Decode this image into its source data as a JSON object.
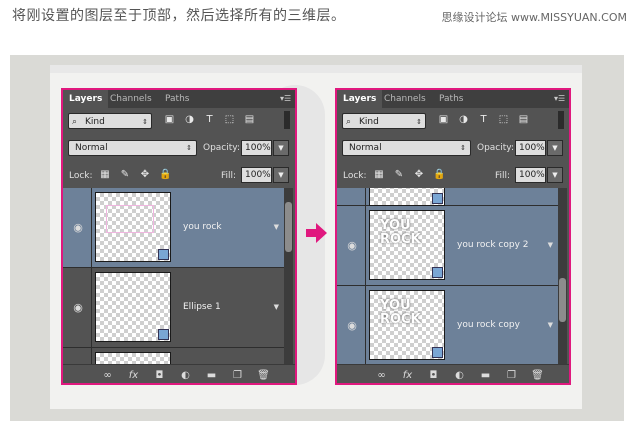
{
  "caption": "将刚设置的图层至于顶部，然后选择所有的三维层。",
  "watermark": "思缘设计论坛 www.MISSYUAN.COM",
  "colors": {
    "highlight_border": "#e0187e",
    "selected_layer": "#6d8199",
    "panel_bg": "#535353"
  },
  "panels": [
    {
      "tabs": [
        "Layers",
        "Channels",
        "Paths"
      ],
      "filter": {
        "label": "Kind",
        "icon": "search-icon"
      },
      "blend_mode": "Normal",
      "opacity_label": "Opacity:",
      "opacity_value": "100%",
      "lock_label": "Lock:",
      "fill_label": "Fill:",
      "fill_value": "100%",
      "layers": [
        {
          "name": "you rock",
          "selected": true
        },
        {
          "name": "Ellipse 1",
          "selected": false
        }
      ]
    },
    {
      "tabs": [
        "Layers",
        "Channels",
        "Paths"
      ],
      "filter": {
        "label": "Kind",
        "icon": "search-icon"
      },
      "blend_mode": "Normal",
      "opacity_label": "Opacity:",
      "opacity_value": "100%",
      "lock_label": "Lock:",
      "fill_label": "Fill:",
      "fill_value": "100%",
      "layers": [
        {
          "name": "you rock copy 2",
          "selected": true
        },
        {
          "name": "you rock copy",
          "selected": true
        }
      ]
    }
  ],
  "arrow_icon": "arrow-right-icon"
}
